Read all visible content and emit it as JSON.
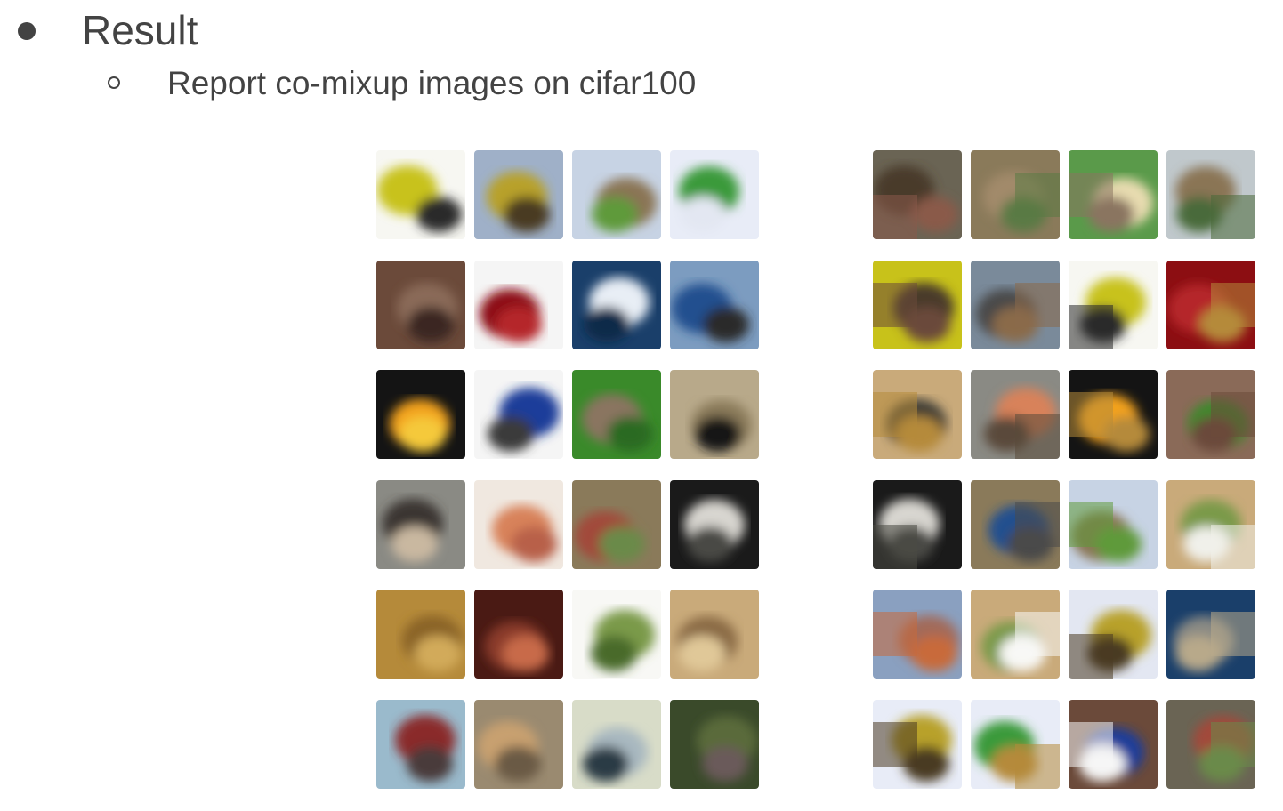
{
  "slide": {
    "heading": "Result",
    "subheading": "Report co-mixup images on cifar100"
  },
  "original_images": [
    {
      "name": "motorcycle-yellow",
      "colors": [
        "#f7f7f2",
        "#c8c21a",
        "#2a2a2a"
      ]
    },
    {
      "name": "bulldozer",
      "colors": [
        "#9fb0c8",
        "#b8a12a",
        "#4a3a22"
      ]
    },
    {
      "name": "castle",
      "colors": [
        "#c7d3e4",
        "#8a7554",
        "#5f9a3a"
      ]
    },
    {
      "name": "hamburger-plate",
      "colors": [
        "#e8ecf7",
        "#3a9a3a",
        "#e3e7f2"
      ]
    },
    {
      "name": "animal-face-brown",
      "colors": [
        "#6b4a3a",
        "#8a6a58",
        "#3b2820"
      ]
    },
    {
      "name": "apple-red",
      "colors": [
        "#f5f5f5",
        "#8c0e12",
        "#b5252a"
      ]
    },
    {
      "name": "whale-blue",
      "colors": [
        "#1a3f6a",
        "#e8eef5",
        "#0f2a4a"
      ]
    },
    {
      "name": "motorcycle-blue",
      "colors": [
        "#7c9cc0",
        "#23508f",
        "#2a2a2a"
      ]
    },
    {
      "name": "oranges",
      "colors": [
        "#141414",
        "#f3a21a",
        "#f5c93a"
      ]
    },
    {
      "name": "dirt-bike-blue",
      "colors": [
        "#f5f5f5",
        "#1f3e9a",
        "#3a3a3a"
      ]
    },
    {
      "name": "rabbit",
      "colors": [
        "#3a8a2a",
        "#8a7560",
        "#2a6a22"
      ]
    },
    {
      "name": "mole-ground",
      "colors": [
        "#b8a98a",
        "#8a7a5a",
        "#141414"
      ]
    },
    {
      "name": "elephant",
      "colors": [
        "#8a8a84",
        "#3a3630",
        "#c9b8a0"
      ]
    },
    {
      "name": "baby",
      "colors": [
        "#f0e8e0",
        "#d8825a",
        "#b8604a"
      ]
    },
    {
      "name": "tractor-red",
      "colors": [
        "#8a7a5a",
        "#a24a3a",
        "#6a8a4a"
      ]
    },
    {
      "name": "face-closeup",
      "colors": [
        "#1a1a1a",
        "#d8d6d0",
        "#4a4a44"
      ]
    },
    {
      "name": "wardrobe-wood",
      "colors": [
        "#b58a3a",
        "#8a6428",
        "#d2aa5a"
      ]
    },
    {
      "name": "carpet-red",
      "colors": [
        "#4a1a14",
        "#8a3a2a",
        "#c86a4a"
      ]
    },
    {
      "name": "dinosaur-green",
      "colors": [
        "#f8f8f5",
        "#7a9a4a",
        "#4a6a2a"
      ]
    },
    {
      "name": "hands-closeup",
      "colors": [
        "#c9aa7a",
        "#8a6a44",
        "#e0c898"
      ]
    },
    {
      "name": "train-red",
      "colors": [
        "#9abacc",
        "#8a2a2a",
        "#4a3a3a"
      ]
    },
    {
      "name": "kangaroo",
      "colors": [
        "#9a8a70",
        "#c8a070",
        "#6a5a44"
      ]
    },
    {
      "name": "sky-mountain",
      "colors": [
        "#d8dcc8",
        "#a8b8c0",
        "#2a3a44"
      ]
    },
    {
      "name": "grass-field",
      "colors": [
        "#3a4a2a",
        "#5a6a3a",
        "#6a5a5a"
      ]
    }
  ],
  "mixed_images": [
    {
      "name": "mix-tractor-face",
      "colors": [
        "#6a6454",
        "#4a3a2a",
        "#8a5a4a"
      ]
    },
    {
      "name": "mix-cat-tractor",
      "colors": [
        "#8a7a5a",
        "#a28a6a",
        "#5a7a44"
      ]
    },
    {
      "name": "mix-rabbit-box",
      "colors": [
        "#5a9a4a",
        "#e8dcb0",
        "#8a7560"
      ]
    },
    {
      "name": "mix-castle-tractor",
      "colors": [
        "#c0c8cc",
        "#8a7554",
        "#4a6a3a"
      ]
    },
    {
      "name": "mix-moto-face",
      "colors": [
        "#c8c21a",
        "#4a3a2a",
        "#6b4a3a"
      ]
    },
    {
      "name": "mix-train-moto",
      "colors": [
        "#7a8a9a",
        "#4a4a4a",
        "#8a6a4a"
      ]
    },
    {
      "name": "mix-moto-yellow",
      "colors": [
        "#f7f7f2",
        "#c8c21a",
        "#2a2a2a"
      ]
    },
    {
      "name": "mix-apple-wood",
      "colors": [
        "#8c0e12",
        "#b5252a",
        "#b58a3a"
      ]
    },
    {
      "name": "mix-hand-mole",
      "colors": [
        "#c9aa7a",
        "#3a3a34",
        "#b58a3a"
      ]
    },
    {
      "name": "mix-baby-tractor",
      "colors": [
        "#8a8a84",
        "#d8825a",
        "#5a4a3a"
      ]
    },
    {
      "name": "mix-oranges-wood",
      "colors": [
        "#141414",
        "#f3a21a",
        "#b58a3a"
      ]
    },
    {
      "name": "mix-face-rabbit",
      "colors": [
        "#8a6a58",
        "#3a8a2a",
        "#6b4a3a"
      ]
    },
    {
      "name": "mix-face-closeup",
      "colors": [
        "#1a1a1a",
        "#d8d6d0",
        "#4a4a44"
      ]
    },
    {
      "name": "mix-cat-moto",
      "colors": [
        "#8a7a5a",
        "#23508f",
        "#4a4a4a"
      ]
    },
    {
      "name": "mix-castle-green",
      "colors": [
        "#c7d3e4",
        "#8a7554",
        "#5f9a3a"
      ]
    },
    {
      "name": "mix-hand-dino",
      "colors": [
        "#c9aa7a",
        "#7a9a4a",
        "#f0f0ea"
      ]
    },
    {
      "name": "mix-octopus-tractor",
      "colors": [
        "#8aa0c0",
        "#a26a5a",
        "#c86a3a"
      ]
    },
    {
      "name": "mix-hand-dino-2",
      "colors": [
        "#c9aa7a",
        "#7a9a4a",
        "#f8f8f5"
      ]
    },
    {
      "name": "mix-plate-bulldozer",
      "colors": [
        "#e3e7f2",
        "#b8a12a",
        "#4a3a22"
      ]
    },
    {
      "name": "mix-whale-mole",
      "colors": [
        "#1a3f6a",
        "#8a8a84",
        "#b8a98a"
      ]
    },
    {
      "name": "mix-plate-bulldozer-2",
      "colors": [
        "#e8ecf7",
        "#b8a12a",
        "#4a3a22"
      ]
    },
    {
      "name": "mix-burger-wood",
      "colors": [
        "#e8ecf7",
        "#3a9a3a",
        "#b58a3a"
      ]
    },
    {
      "name": "mix-face-dirtbike",
      "colors": [
        "#6b4a3a",
        "#1f3e9a",
        "#f5f5f5"
      ]
    },
    {
      "name": "mix-tractor-red",
      "colors": [
        "#6a6454",
        "#a24a3a",
        "#6a8a4a"
      ]
    }
  ]
}
